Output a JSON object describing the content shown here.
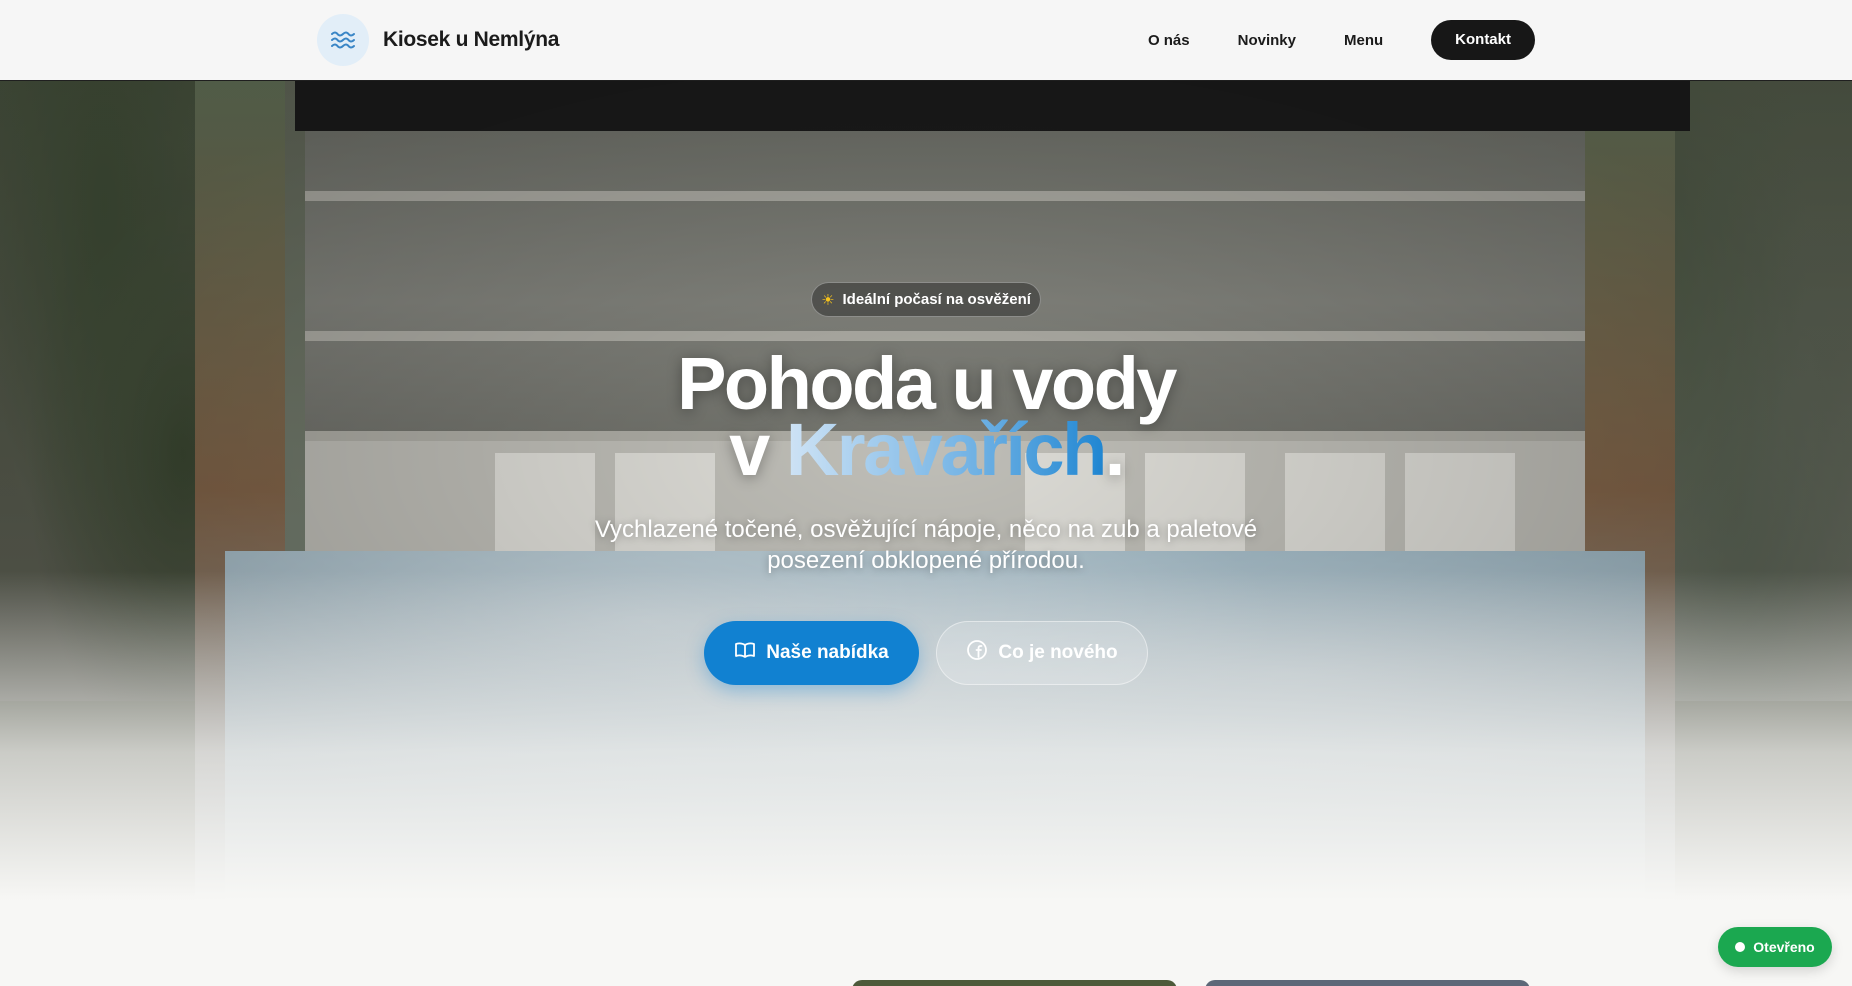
{
  "header": {
    "brand_name": "Kiosek u Nemlýna",
    "brand_icon": "waves-icon",
    "nav": [
      {
        "label": "O nás"
      },
      {
        "label": "Novinky"
      },
      {
        "label": "Menu"
      }
    ],
    "cta_label": "Kontakt"
  },
  "hero": {
    "badge": {
      "icon": "sun-icon",
      "text": "Ideální počasí na osvěžení"
    },
    "title_line1": "Pohoda u vody",
    "title_line2_prefix": "v ",
    "title_line2_highlight": "Kravařích",
    "title_line2_suffix": ".",
    "subtitle": "Vychlazené točené, osvěžující nápoje, něco na zub a paletové posezení obklopené přírodou.",
    "primary_button": {
      "icon": "book-open-icon",
      "label": "Naše nabídka"
    },
    "secondary_button": {
      "icon": "facebook-icon",
      "label": "Co je nového"
    }
  },
  "status_badge": {
    "label": "Otevřeno"
  },
  "colors": {
    "accent": "#1181d1",
    "dark": "#171717",
    "status_open": "#1ba850"
  }
}
